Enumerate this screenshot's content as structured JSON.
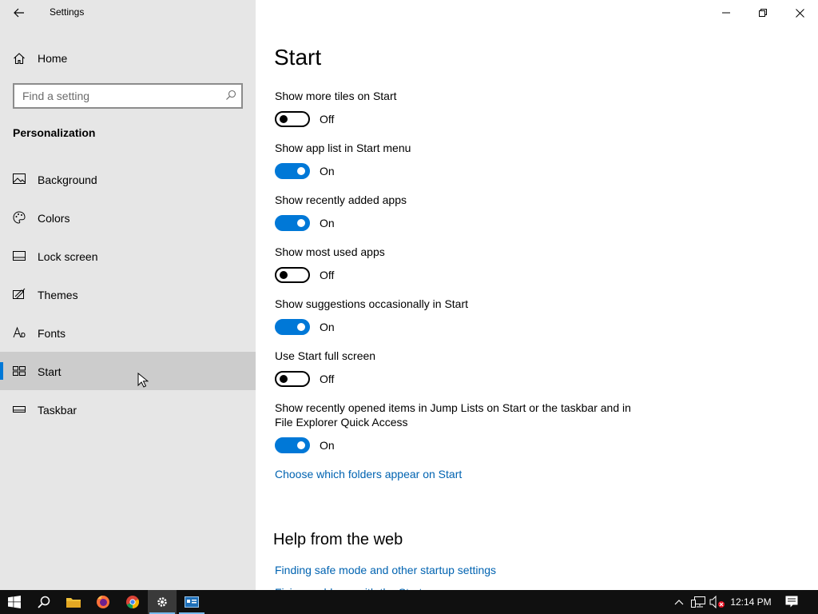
{
  "window": {
    "title": "Settings"
  },
  "sidebar": {
    "home_label": "Home",
    "search_placeholder": "Find a setting",
    "section": "Personalization",
    "items": [
      {
        "label": "Background",
        "icon": "picture-icon"
      },
      {
        "label": "Colors",
        "icon": "palette-icon"
      },
      {
        "label": "Lock screen",
        "icon": "lock-screen-icon"
      },
      {
        "label": "Themes",
        "icon": "themes-icon"
      },
      {
        "label": "Fonts",
        "icon": "fonts-icon"
      },
      {
        "label": "Start",
        "icon": "start-icon",
        "selected": true
      },
      {
        "label": "Taskbar",
        "icon": "taskbar-icon"
      }
    ]
  },
  "main": {
    "title": "Start",
    "settings": [
      {
        "label": "Show more tiles on Start",
        "on": false,
        "state": "Off"
      },
      {
        "label": "Show app list in Start menu",
        "on": true,
        "state": "On"
      },
      {
        "label": "Show recently added apps",
        "on": true,
        "state": "On"
      },
      {
        "label": "Show most used apps",
        "on": false,
        "state": "Off"
      },
      {
        "label": "Show suggestions occasionally in Start",
        "on": true,
        "state": "On"
      },
      {
        "label": "Use Start full screen",
        "on": false,
        "state": "Off"
      },
      {
        "label": "Show recently opened items in Jump Lists on Start or the taskbar and in File Explorer Quick Access",
        "on": true,
        "state": "On"
      }
    ],
    "folders_link": "Choose which folders appear on Start",
    "help_title": "Help from the web",
    "help_links": [
      "Finding safe mode and other startup settings",
      "Fixing problems with the Start menu"
    ]
  },
  "taskbar": {
    "apps": [
      "windows-start-icon",
      "search-icon",
      "file-explorer-icon",
      "firefox-icon",
      "chrome-icon",
      "settings-gear-icon",
      "control-panel-icon"
    ],
    "time": "12:14 PM"
  },
  "colors": {
    "accent": "#0078d7",
    "link": "#0063b1",
    "sidebar_bg": "#e6e6e6",
    "taskbar_bg": "#101010"
  }
}
